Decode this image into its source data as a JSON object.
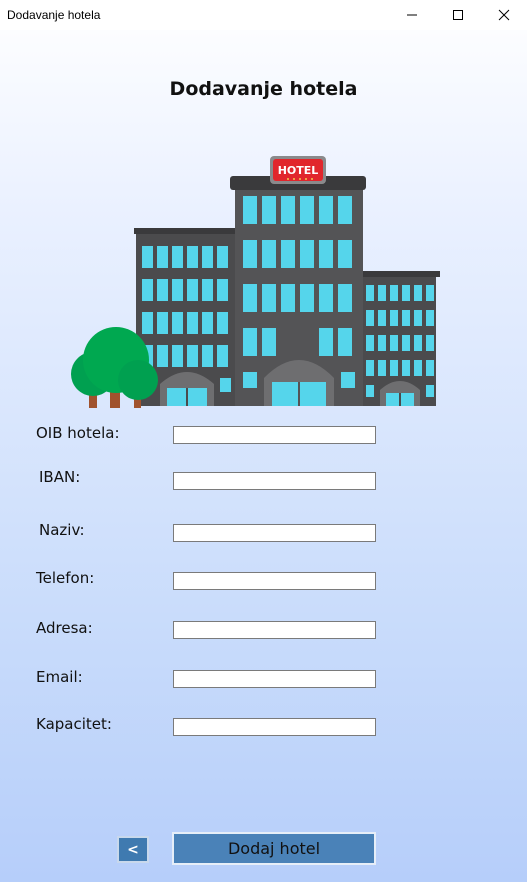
{
  "window": {
    "title": "Dodavanje hotela",
    "icons": [
      "minimize-icon",
      "maximize-icon",
      "close-icon"
    ]
  },
  "heading": "Dodavanje hotela",
  "illustration": {
    "sign_text": "HOTEL",
    "icon": "hotel-building-illustration"
  },
  "form": {
    "fields": [
      {
        "label": "OIB hotela:",
        "value": ""
      },
      {
        "label": "IBAN:",
        "value": ""
      },
      {
        "label": "Naziv:",
        "value": ""
      },
      {
        "label": "Telefon:",
        "value": ""
      },
      {
        "label": "Adresa:",
        "value": ""
      },
      {
        "label": "Email:",
        "value": ""
      },
      {
        "label": "Kapacitet:",
        "value": ""
      }
    ]
  },
  "buttons": {
    "back": "<",
    "add": "Dodaj hotel"
  },
  "colors": {
    "button": "#4a82b8",
    "window_start": "#ffffff",
    "window_end": "#b6cefa"
  }
}
